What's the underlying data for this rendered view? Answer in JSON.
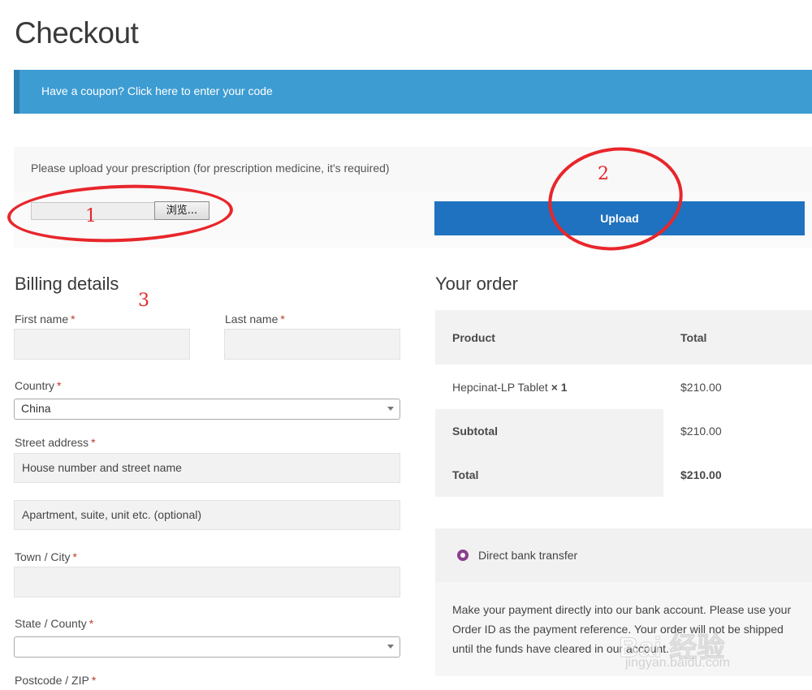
{
  "page": {
    "title": "Checkout"
  },
  "coupon": {
    "text": "Have a coupon? Click here to enter your code",
    "color": "#3d9cd2"
  },
  "prescription": {
    "label": "Please upload your prescription (for prescription medicine, it's required)",
    "browse_label": "浏览...",
    "upload_label": "Upload"
  },
  "billing": {
    "title": "Billing details",
    "first_name": {
      "label": "First name",
      "required": "*"
    },
    "last_name": {
      "label": "Last name",
      "required": "*"
    },
    "country": {
      "label": "Country",
      "required": "*",
      "value": "China"
    },
    "street": {
      "label": "Street address",
      "required": "*",
      "placeholder1": "House number and street name",
      "placeholder2": "Apartment, suite, unit etc. (optional)"
    },
    "city": {
      "label": "Town / City",
      "required": "*"
    },
    "state": {
      "label": "State / County",
      "required": "*",
      "value": ""
    },
    "postcode": {
      "label": "Postcode / ZIP",
      "required": "*"
    }
  },
  "order": {
    "title": "Your order",
    "header_product": "Product",
    "header_total": "Total",
    "item_name": "Hepcinat-LP Tablet",
    "item_qty": "× 1",
    "item_total": "$210.00",
    "subtotal_label": "Subtotal",
    "subtotal_value": "$210.00",
    "total_label": "Total",
    "total_value": "$210.00"
  },
  "payment": {
    "method": "Direct bank transfer",
    "description": "Make your payment directly into our bank account. Please use your Order ID as the payment reference. Your order will not be shipped until the funds have cleared in our account.",
    "radio_color": "#8a3f8f"
  },
  "annotations": {
    "one": "1",
    "two": "2",
    "three": "3",
    "color": "#e8262b"
  },
  "watermark": {
    "main": "Bai 经验",
    "sub": "jingyan.baidu.com"
  }
}
